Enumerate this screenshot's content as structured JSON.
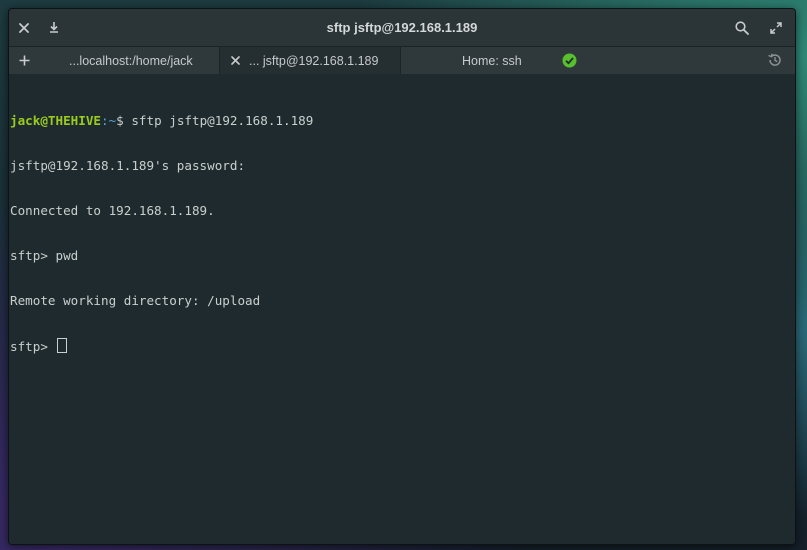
{
  "window": {
    "title": "sftp jsftp@192.168.1.189"
  },
  "titlebar": {
    "close_icon": "close-icon",
    "download_icon": "download-icon",
    "search_icon": "search-icon",
    "maximize_icon": "maximize-icon"
  },
  "tabs": [
    {
      "label": "...localhost:/home/jack",
      "active": false
    },
    {
      "label": "... jsftp@192.168.1.189",
      "active": true
    },
    {
      "label": "Home: ssh",
      "active": false
    }
  ],
  "tabbar": {
    "new_tab_icon": "plus-icon",
    "close_tab_icon": "close-icon",
    "status_icon": "check-circle-icon",
    "history_icon": "history-icon",
    "status_color": "#58c02d"
  },
  "terminal": {
    "prompt_user": "jack@THEHIVE",
    "prompt_path": ":~",
    "prompt_symbol": "$ ",
    "command": "sftp jsftp@192.168.1.189",
    "lines": [
      "jsftp@192.168.1.189's password:",
      "Connected to 192.168.1.189.",
      "sftp> pwd",
      "Remote working directory: /upload"
    ],
    "current_prompt": "sftp> "
  }
}
